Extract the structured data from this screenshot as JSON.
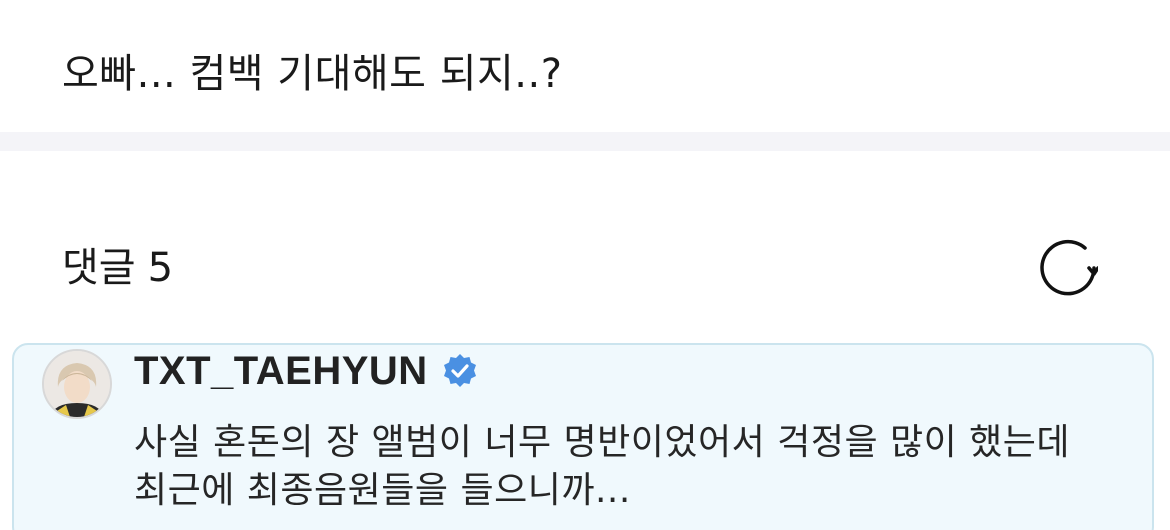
{
  "post": {
    "text": "오빠... 컴백 기대해도 되지..?"
  },
  "comments": {
    "label": "댓글",
    "count": "5",
    "refresh_icon": "refresh-icon"
  },
  "comment_list": [
    {
      "username": "TXT_TAEHYUN",
      "verified": true,
      "verified_color": "#4a90e2",
      "body": "사실 혼돈의 장 앨범이 너무 명반이었어서 걱정을 많이 했는데 최근에 최종음원들을 들으니까..."
    }
  ],
  "colors": {
    "highlight_bg": "#f0f9fd",
    "highlight_border": "#cbe4ee",
    "divider": "#f4f4f8"
  }
}
